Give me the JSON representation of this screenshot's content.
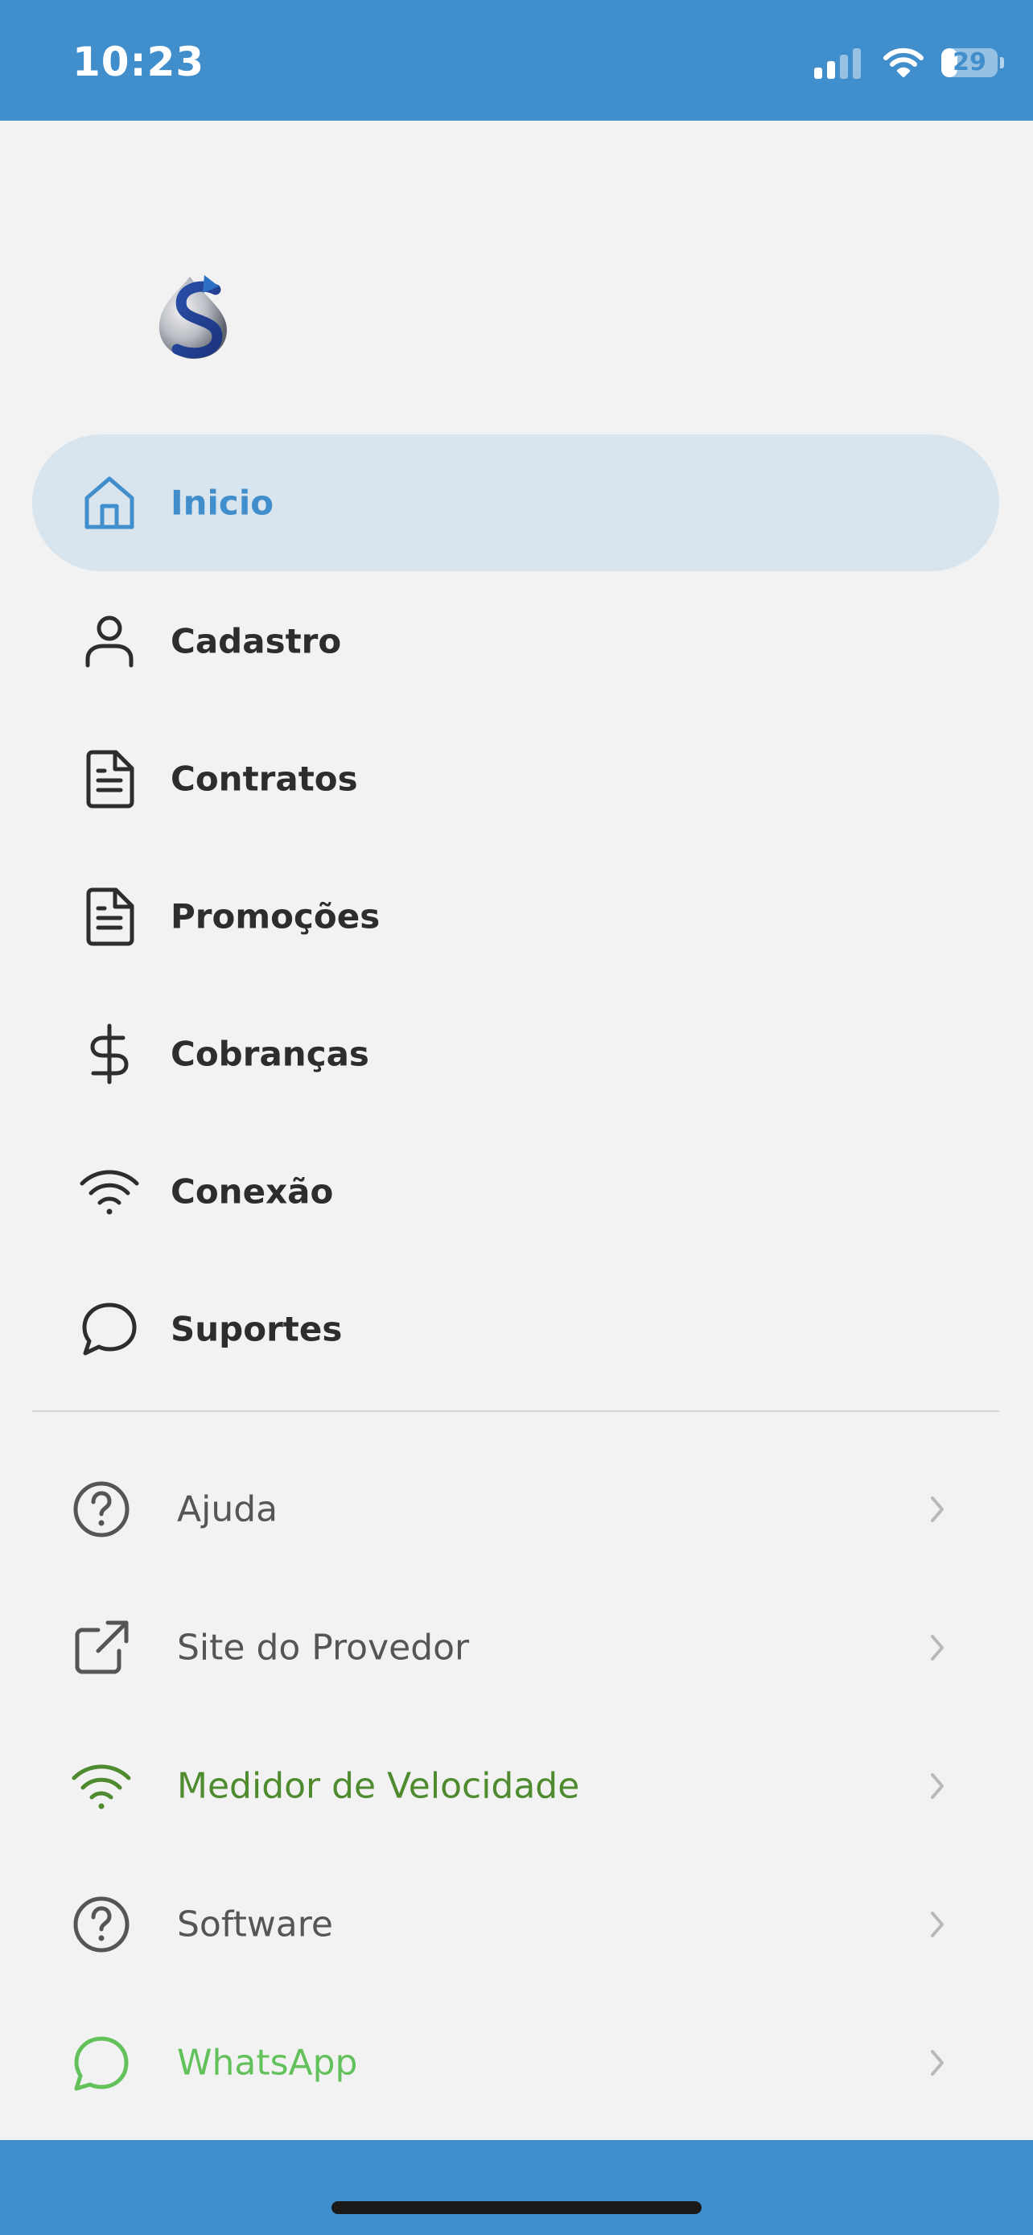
{
  "status_bar": {
    "time": "10:23",
    "battery": "29",
    "battery_level": 0.29
  },
  "logo": {
    "icon": "provider-logo"
  },
  "nav": {
    "items": [
      {
        "label": "Inicio",
        "icon": "home-icon",
        "active": true
      },
      {
        "label": "Cadastro",
        "icon": "user-icon",
        "active": false
      },
      {
        "label": "Contratos",
        "icon": "document-icon",
        "active": false
      },
      {
        "label": "Promoções",
        "icon": "document-icon",
        "active": false
      },
      {
        "label": "Cobranças",
        "icon": "dollar-icon",
        "active": false
      },
      {
        "label": "Conexão",
        "icon": "wifi-icon",
        "active": false
      },
      {
        "label": "Suportes",
        "icon": "chat-bubble-icon",
        "active": false
      }
    ]
  },
  "links": {
    "items": [
      {
        "label": "Ajuda",
        "icon": "help-circle-icon",
        "color": "#555555"
      },
      {
        "label": "Site do Provedor",
        "icon": "external-link-icon",
        "color": "#555555"
      },
      {
        "label": "Medidor de Velocidade",
        "icon": "wifi-icon",
        "color": "#4e8a2e"
      },
      {
        "label": "Software",
        "icon": "help-circle-icon",
        "color": "#555555"
      },
      {
        "label": "WhatsApp",
        "icon": "whatsapp-icon",
        "color": "#62c15b"
      }
    ]
  },
  "colors": {
    "primary": "#418ecc",
    "active_bg": "#d9e5ee",
    "text": "#2d2d2d",
    "background": "#f2f2f2"
  }
}
